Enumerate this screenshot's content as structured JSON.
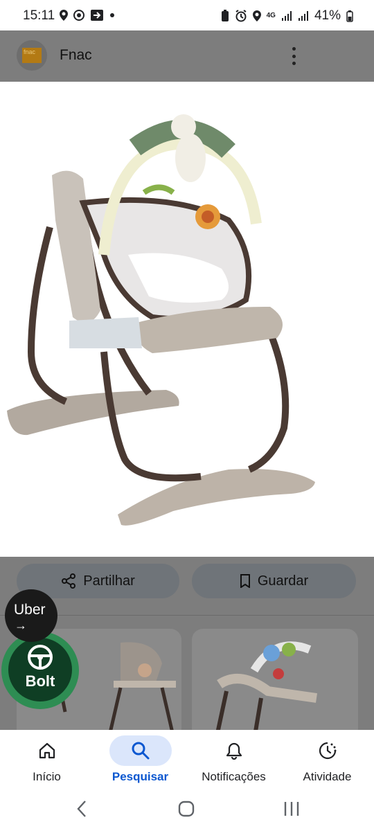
{
  "status_bar": {
    "time": "15:11",
    "network": "4G",
    "battery": "41%",
    "icons_left": [
      "location-pin-icon",
      "chrome-icon",
      "cast-exit-icon",
      "dot-icon"
    ],
    "icons_right": [
      "battery-saver-icon",
      "alarm-icon",
      "location-icon",
      "network-icon",
      "signal-icon",
      "signal-icon",
      "battery-icon"
    ]
  },
  "header": {
    "source_logo_text": "fnac",
    "source_name": "Fnac",
    "menu_icon": "more-vert-icon"
  },
  "actions": {
    "share_label": "Partilhar",
    "save_label": "Guardar"
  },
  "overlays": {
    "uber_label": "Uber",
    "uber_arrow": "→",
    "bolt_label": "Bolt"
  },
  "bottom_nav": {
    "items": [
      {
        "label": "Início",
        "icon": "home-icon",
        "active": false
      },
      {
        "label": "Pesquisar",
        "icon": "search-icon",
        "active": true
      },
      {
        "label": "Notificações",
        "icon": "bell-icon",
        "active": false
      },
      {
        "label": "Atividade",
        "icon": "activity-icon",
        "active": false
      }
    ]
  },
  "system_nav": [
    "back-icon",
    "home-circle-icon",
    "recents-icon"
  ],
  "colors": {
    "accent": "#0b57d0",
    "active_pill": "#dbe6fb",
    "overlay_gray": "#7d7d7d",
    "bolt_green": "#2e8d53"
  }
}
